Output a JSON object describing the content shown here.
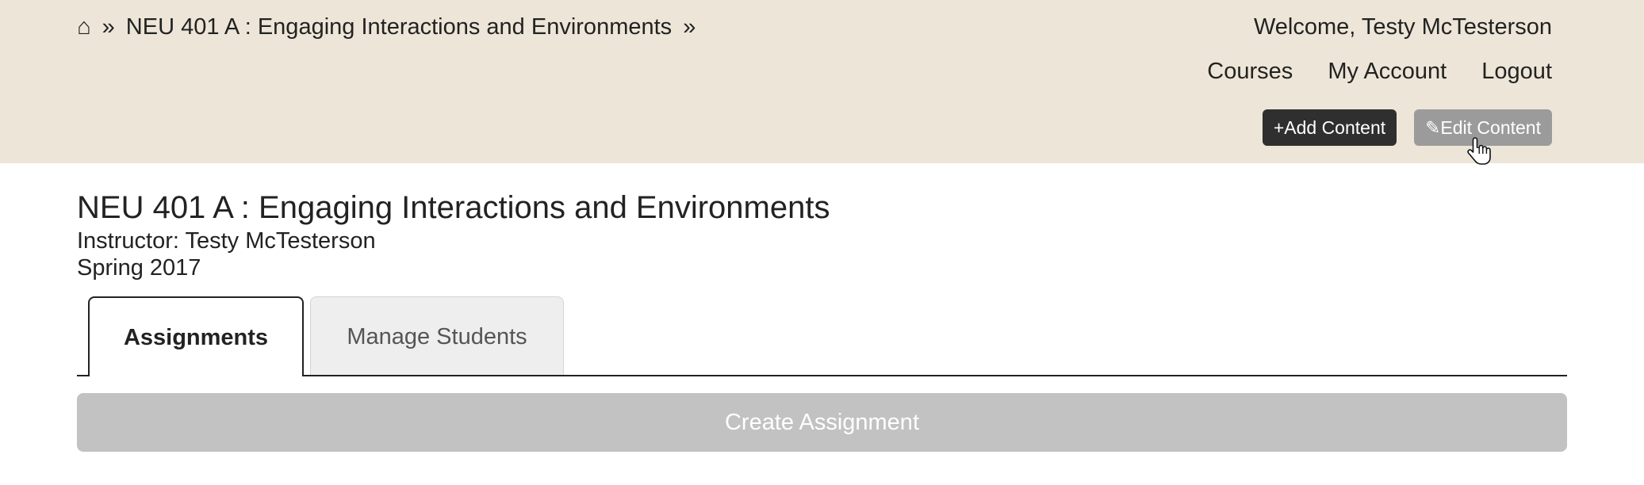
{
  "header": {
    "breadcrumb": {
      "home_icon": "⌂",
      "separator": "»",
      "course": "NEU 401 A : Engaging Interactions and Environments",
      "trailing_separator": "»"
    },
    "welcome": "Welcome, Testy McTesterson",
    "nav": {
      "courses": "Courses",
      "my_account": "My Account",
      "logout": "Logout"
    },
    "buttons": {
      "add_content": "+Add Content",
      "edit_content": "✎Edit Content"
    }
  },
  "course": {
    "title": "NEU 401 A : Engaging Interactions and Environments",
    "instructor": "Instructor: Testy McTesterson",
    "term": "Spring 2017"
  },
  "tabs": [
    {
      "label": "Assignments",
      "active": true
    },
    {
      "label": "Manage Students",
      "active": false
    }
  ],
  "actions": {
    "create_assignment": "Create Assignment"
  },
  "colors": {
    "header_bg": "#ede6d8",
    "dark_button": "#2f2f2f",
    "gray_button": "#9b9b9b",
    "create_button": "#c2c2c2"
  }
}
